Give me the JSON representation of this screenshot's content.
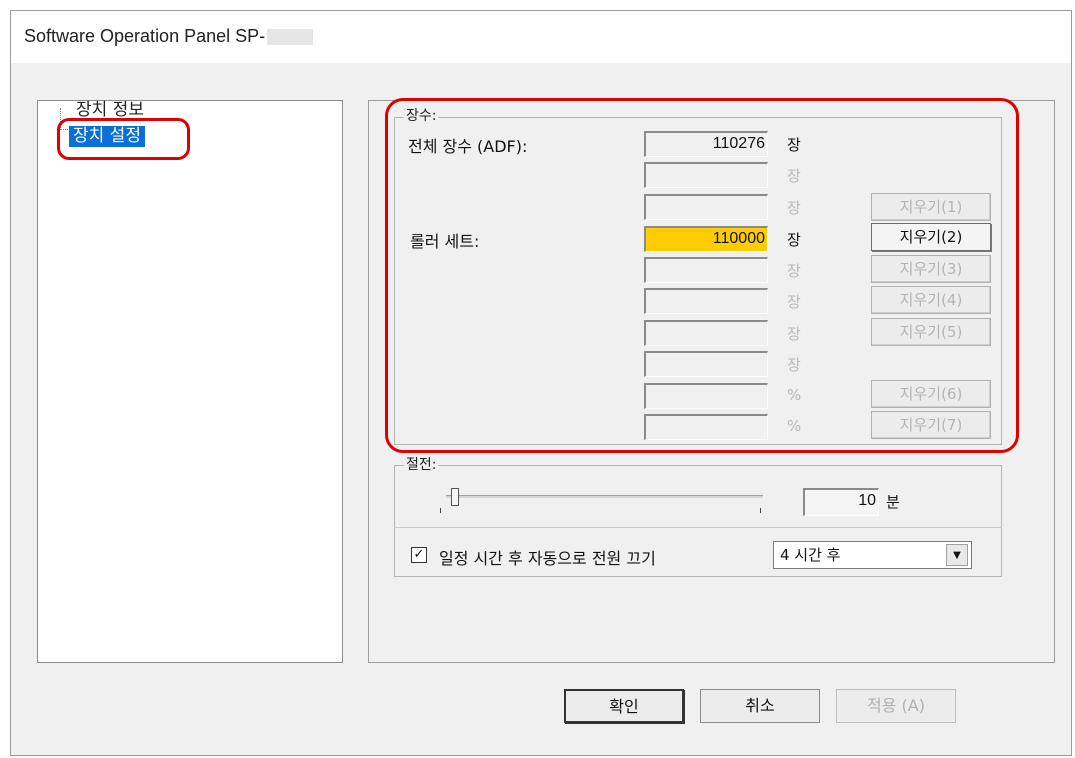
{
  "window": {
    "title": "Software Operation Panel SP-"
  },
  "tree": {
    "items": [
      {
        "label": "장치 정보"
      },
      {
        "label": "장치 설정"
      }
    ]
  },
  "counter_group": {
    "label": "장수:",
    "total_label": "전체 장수 (ADF):",
    "total_value": "110276",
    "roller_label": "롤러 세트:",
    "roller_value": "110000",
    "rows": [
      {
        "value": "110276",
        "unit": "장"
      },
      {
        "value": "",
        "unit": "장"
      },
      {
        "value": "",
        "unit": "장"
      },
      {
        "value": "110000",
        "unit": "장"
      },
      {
        "value": "",
        "unit": "장"
      },
      {
        "value": "",
        "unit": "장"
      },
      {
        "value": "",
        "unit": "장"
      },
      {
        "value": "",
        "unit": "장"
      },
      {
        "value": "",
        "unit": "%"
      },
      {
        "value": "",
        "unit": "%"
      }
    ],
    "clear_buttons": [
      {
        "label": "지우기(1)"
      },
      {
        "label": "지우기(2)"
      },
      {
        "label": "지우기(3)"
      },
      {
        "label": "지우기(4)"
      },
      {
        "label": "지우기(5)"
      },
      {
        "label": "지우기(6)"
      },
      {
        "label": "지우기(7)"
      }
    ]
  },
  "power_group": {
    "label": "절전:",
    "minutes_value": "10",
    "minutes_unit": "분",
    "slider_value_minutes": 10,
    "auto_off_checked": true,
    "auto_off_checkmark": "✓",
    "auto_off_label": "일정 시간 후 자동으로 전원 끄기",
    "auto_off_selected": "4 시간 후",
    "combo_arrow": "▼"
  },
  "footer": {
    "ok_label": "확인",
    "cancel_label": "취소",
    "apply_label": "적용 (A)"
  },
  "colors": {
    "highlight": "#e00000",
    "selection": "#0a6fd6",
    "roller_highlight": "#ffcc00"
  }
}
